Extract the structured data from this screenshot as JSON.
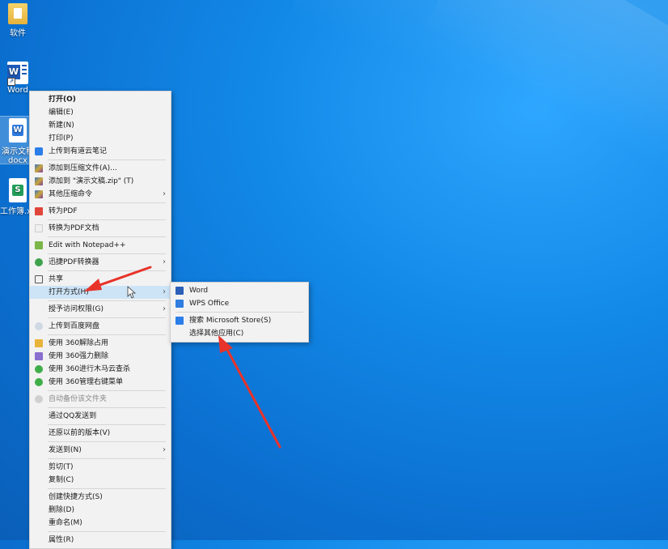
{
  "desktop": {
    "icons": [
      {
        "label": "软件",
        "icon": "folder-icon"
      },
      {
        "label": "Word",
        "icon": "word-shortcut-icon"
      },
      {
        "label": "演示文稿",
        "label2": "docx",
        "icon": "docx-file-icon"
      },
      {
        "label": "工作簿.xls",
        "icon": "xlsx-file-icon"
      }
    ]
  },
  "context_menu": {
    "items": [
      {
        "label": "打开(O)"
      },
      {
        "label": "编辑(E)"
      },
      {
        "label": "新建(N)"
      },
      {
        "label": "打印(P)"
      },
      {
        "label": "上传到有道云笔记"
      },
      {
        "label": "添加到压缩文件(A)..."
      },
      {
        "label": "添加到 \"演示文稿.zip\" (T)"
      },
      {
        "label": "其他压缩命令"
      },
      {
        "label": "转为PDF"
      },
      {
        "label": "转换为PDF文档"
      },
      {
        "label": "Edit with Notepad++"
      },
      {
        "label": "迅捷PDF转换器"
      },
      {
        "label": "共享"
      },
      {
        "label": "打开方式(H)"
      },
      {
        "label": "授予访问权限(G)"
      },
      {
        "label": "上传到百度网盘"
      },
      {
        "label": "使用 360解除占用"
      },
      {
        "label": "使用 360强力删除"
      },
      {
        "label": "使用 360进行木马云查杀"
      },
      {
        "label": "使用 360管理右键菜单"
      },
      {
        "label": "自动备份该文件夹"
      },
      {
        "label": "通过QQ发送到"
      },
      {
        "label": "还原以前的版本(V)"
      },
      {
        "label": "发送到(N)"
      },
      {
        "label": "剪切(T)"
      },
      {
        "label": "复制(C)"
      },
      {
        "label": "创建快捷方式(S)"
      },
      {
        "label": "删除(D)"
      },
      {
        "label": "重命名(M)"
      },
      {
        "label": "属性(R)"
      }
    ]
  },
  "open_with_menu": {
    "items": [
      {
        "label": "Word"
      },
      {
        "label": "WPS Office"
      },
      {
        "label": "搜索 Microsoft Store(S)"
      },
      {
        "label": "选择其他应用(C)"
      }
    ]
  },
  "colors": {
    "desktop_blue": "#138ae8",
    "menu_bg": "#f2f2f2",
    "highlight": "#cde4f7",
    "annotation_red": "#e8332a"
  }
}
